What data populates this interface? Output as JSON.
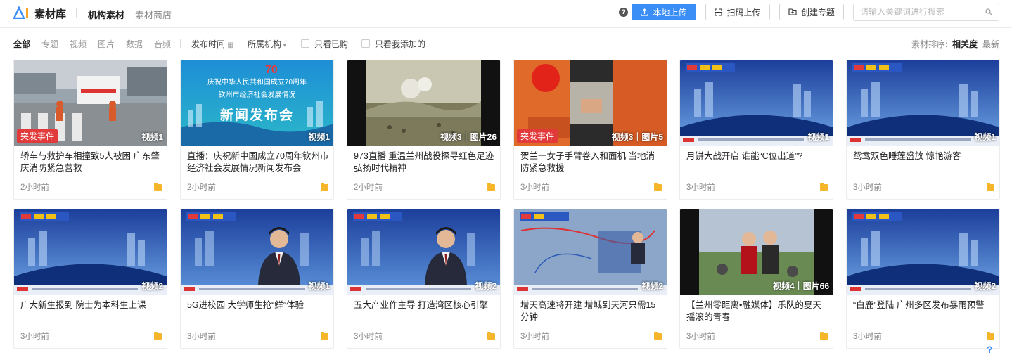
{
  "header": {
    "brand": "素材库",
    "nav": [
      "机构素材",
      "素材商店"
    ],
    "buttons": {
      "upload_local": "本地上传",
      "scan_upload": "扫码上传",
      "create_topic": "创建专题"
    },
    "search_placeholder": "请输入关键词进行搜索",
    "accent": "#3a8ef6"
  },
  "filters": {
    "types": [
      "全部",
      "专题",
      "视频",
      "图片",
      "数据",
      "音频"
    ],
    "publish_time": "发布时间",
    "org": "所属机构",
    "only_bought": "只看已购",
    "only_mine": "只看我添加的",
    "sort_label": "素材排序:",
    "sort_relevance": "相关度",
    "sort_latest": "最新"
  },
  "cards": [
    {
      "title": "轿车与救护车相撞致5人被困 广东肇庆消防紧急营救",
      "time": "2小时前",
      "badge": "突发事件",
      "count": "视频1",
      "thumb": "street"
    },
    {
      "title": "直播：庆祝新中国成立70周年钦州市经济社会发展情况新闻发布会",
      "time": "2小时前",
      "badge": "",
      "count": "视频1",
      "thumb": "press",
      "thumb_text": {
        "line1": "庆祝中华人民共和国成立70周年",
        "line2": "钦州市经济社会发展情况",
        "line3": "新闻发布会"
      }
    },
    {
      "title": "973直播|重温兰州战役探寻红色足迹 弘扬时代精神",
      "time": "2小时前",
      "badge": "",
      "count": "视频3｜图片26",
      "thumb": "battle"
    },
    {
      "title": "贺兰一女子手臂卷入和面机 当地消防紧急救援",
      "time": "3小时前",
      "badge": "突发事件",
      "count": "视频3｜图片5",
      "thumb": "rescue"
    },
    {
      "title": "月饼大战开启 谁能“C位出道”?",
      "time": "3小时前",
      "badge": "",
      "count": "视频1",
      "thumb": "studio"
    },
    {
      "title": "鸳鸯双色睡莲盛放 惊艳游客",
      "time": "3小时前",
      "badge": "",
      "count": "视频1",
      "thumb": "studio"
    },
    {
      "title": "广大新生报到 院士为本科生上课",
      "time": "3小时前",
      "badge": "",
      "count": "视频2",
      "thumb": "studio"
    },
    {
      "title": "5G进校园 大学师生抢“鲜”体验",
      "time": "3小时前",
      "badge": "",
      "count": "视频1",
      "thumb": "anchor"
    },
    {
      "title": "五大产业作主导 打造湾区核心引擎",
      "time": "3小时前",
      "badge": "",
      "count": "视频2",
      "thumb": "anchor"
    },
    {
      "title": "增天高速将开建 增城到天河只需15分钟",
      "time": "3小时前",
      "badge": "",
      "count": "视频2",
      "thumb": "map"
    },
    {
      "title": "【兰州零距离•融媒体】乐队的夏天 摇滚的青春",
      "time": "3小时前",
      "badge": "",
      "count": "视频4｜图片66",
      "thumb": "band"
    },
    {
      "title": "“白鹿”登陆 广州多区发布暴雨预警",
      "time": "3小时前",
      "badge": "",
      "count": "视频2",
      "thumb": "studio"
    }
  ],
  "help": "?"
}
